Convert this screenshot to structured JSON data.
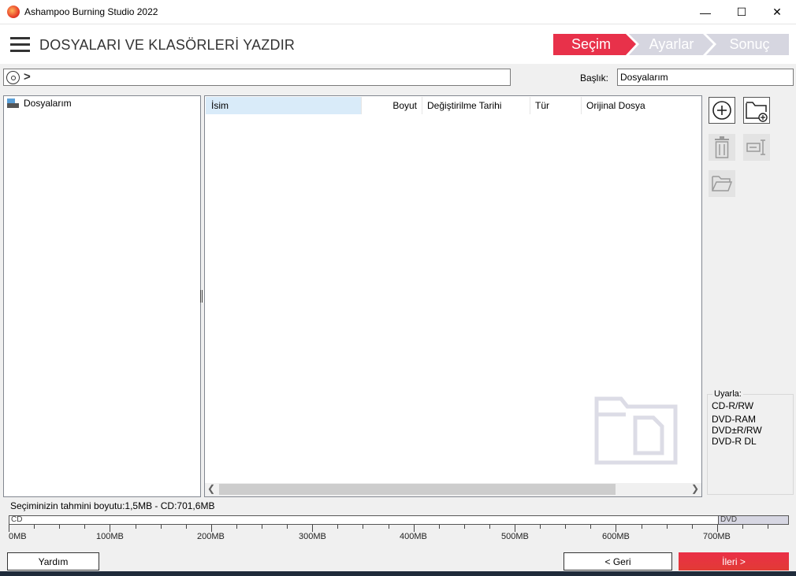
{
  "window": {
    "title": "Ashampoo Burning Studio 2022",
    "controls": {
      "minimize": "—",
      "maximize": "☐",
      "close": "✕"
    }
  },
  "header": {
    "title": "DOSYALARI VE KLASÖRLERİ YAZDIR",
    "steps": [
      {
        "label": "Seçim",
        "active": true
      },
      {
        "label": "Ayarlar",
        "active": false
      },
      {
        "label": "Sonuç",
        "active": false
      }
    ]
  },
  "pathbar": {
    "chevron": ">"
  },
  "disc_title": {
    "label": "Başlık:",
    "value": "Dosyalarım"
  },
  "tree": {
    "items": [
      {
        "label": "Dosyalarım",
        "icon": "drive-icon"
      }
    ]
  },
  "file_list": {
    "columns": [
      "İsim",
      "Boyut",
      "Değiştirilme Tarihi",
      "Tür",
      "Orijinal Dosya"
    ],
    "rows": []
  },
  "warnings": {
    "title": "Uyarla:",
    "lines": [
      "CD-R/RW",
      "DVD-RAM",
      "DVD±R/RW",
      "DVD-R DL"
    ]
  },
  "size": {
    "text": "Seçiminizin tahmini boyutu:1,5MB - CD:701,6MB",
    "cd_label": "CD",
    "dvd_label": "DVD",
    "tick_labels": [
      "0MB",
      "100MB",
      "200MB",
      "300MB",
      "400MB",
      "500MB",
      "600MB",
      "700MB"
    ]
  },
  "footer": {
    "help_label": "Yardım",
    "back_label": "< Geri",
    "next_label": "İleri >"
  },
  "colors": {
    "accent": "#e8314a",
    "step_inactive": "#d6d6e0",
    "selection": "#d9ebf9"
  }
}
